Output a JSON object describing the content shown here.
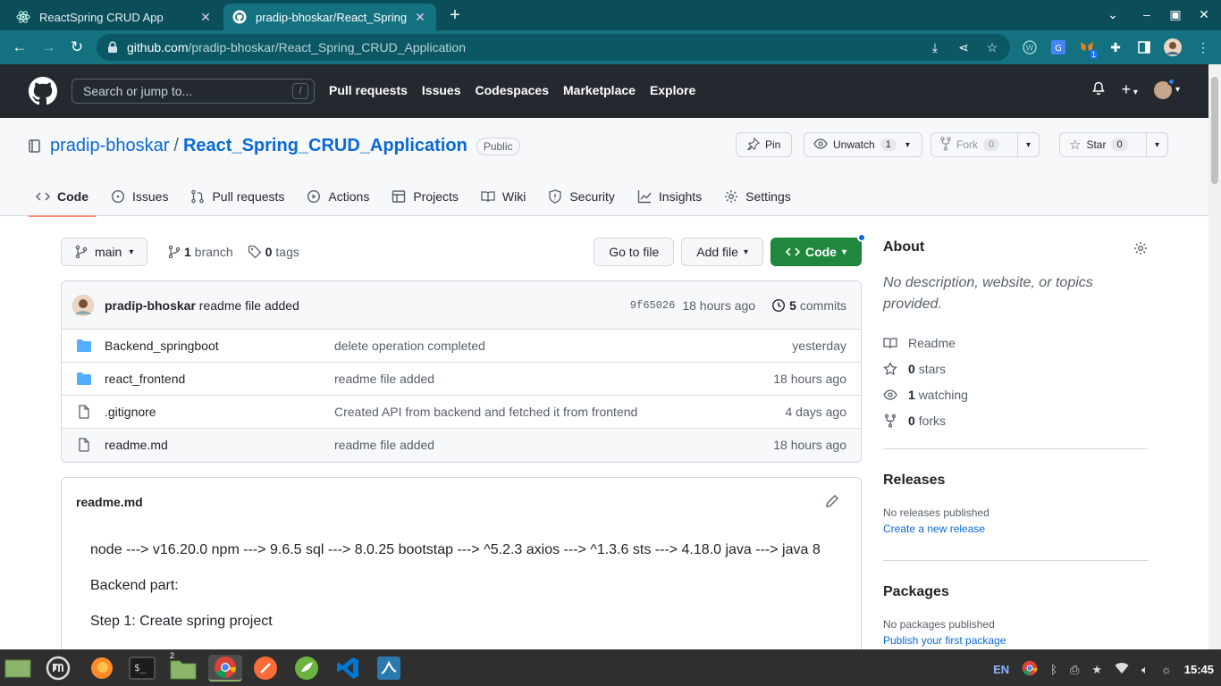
{
  "browser": {
    "tabs": [
      {
        "title": "ReactSpring CRUD App",
        "active": false
      },
      {
        "title": "pradip-bhoskar/React_Spring",
        "active": true
      }
    ],
    "url_host": "github.com",
    "url_path": "/pradip-bhoskar/React_Spring_CRUD_Application",
    "extension_badge": "1"
  },
  "github_header": {
    "search_placeholder": "Search or jump to...",
    "search_shortcut": "/",
    "nav": [
      "Pull requests",
      "Issues",
      "Codespaces",
      "Marketplace",
      "Explore"
    ]
  },
  "repo": {
    "owner": "pradip-bhoskar",
    "separator": "/",
    "name": "React_Spring_CRUD_Application",
    "visibility": "Public",
    "pin_label": "Pin",
    "unwatch_label": "Unwatch",
    "watch_count": "1",
    "fork_label": "Fork",
    "fork_count": "0",
    "star_label": "Star",
    "star_count": "0",
    "tabs": [
      "Code",
      "Issues",
      "Pull requests",
      "Actions",
      "Projects",
      "Wiki",
      "Security",
      "Insights",
      "Settings"
    ]
  },
  "branch_bar": {
    "branch": "main",
    "branch_count": "1",
    "branch_word": "branch",
    "tag_count": "0",
    "tag_word": "tags",
    "go_to_file": "Go to file",
    "add_file": "Add file",
    "code": "Code"
  },
  "latest_commit": {
    "author": "pradip-bhoskar",
    "message": "readme file added",
    "hash": "9f65026",
    "age": "18 hours ago",
    "commit_count": "5",
    "commit_word": "commits"
  },
  "files": [
    {
      "name": "Backend_springboot",
      "type": "dir",
      "message": "delete operation completed",
      "age": "yesterday"
    },
    {
      "name": "react_frontend",
      "type": "dir",
      "message": "readme file added",
      "age": "18 hours ago"
    },
    {
      "name": ".gitignore",
      "type": "file",
      "message": "Created API from backend and fetched it from frontend",
      "age": "4 days ago"
    },
    {
      "name": "readme.md",
      "type": "file",
      "message": "readme file added",
      "age": "18 hours ago"
    }
  ],
  "readme": {
    "title": "readme.md",
    "lines": [
      "node ---> v16.20.0 npm ---> 9.6.5 sql ---> 8.0.25 bootstap ---> ^5.2.3 axios ---> ^1.3.6 sts ---> 4.18.0 java ---> java 8",
      "Backend part:",
      "Step 1: Create spring project"
    ]
  },
  "sidebar": {
    "about_title": "About",
    "about_desc": "No description, website, or topics provided.",
    "readme_label": "Readme",
    "stars_count": "0",
    "stars_word": "stars",
    "watching_count": "1",
    "watching_word": "watching",
    "forks_count": "0",
    "forks_word": "forks",
    "releases_title": "Releases",
    "releases_none": "No releases published",
    "releases_link": "Create a new release",
    "packages_title": "Packages",
    "packages_none": "No packages published",
    "packages_link": "Publish your first package"
  },
  "taskbar": {
    "lang": "EN",
    "clock": "15:45",
    "files_badge": "2"
  },
  "colors": {
    "browser_tabbar": "#0b4e5a",
    "browser_toolbar": "#137180",
    "github_header": "#24292f",
    "link": "#0969da",
    "code_button": "#1f883d",
    "folder": "#54aeff",
    "active_tab_underline": "#fd8c73"
  }
}
